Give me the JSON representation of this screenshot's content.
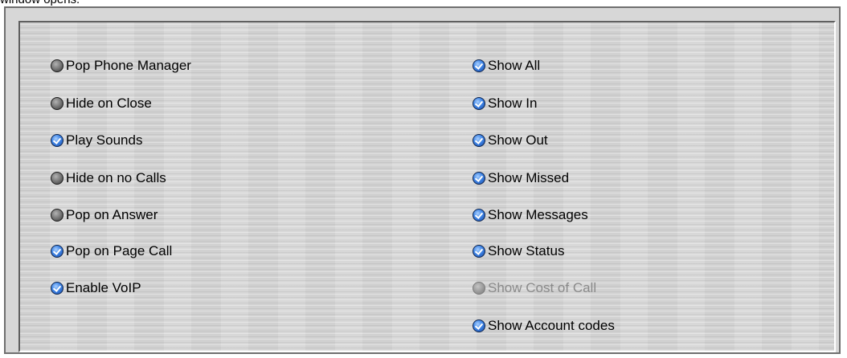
{
  "caption": "window opens.",
  "left_options": [
    {
      "label": "Pop Phone Manager",
      "checked": false,
      "enabled": true
    },
    {
      "label": "Hide on Close",
      "checked": false,
      "enabled": true
    },
    {
      "label": "Play Sounds",
      "checked": true,
      "enabled": true
    },
    {
      "label": "Hide on no Calls",
      "checked": false,
      "enabled": true
    },
    {
      "label": "Pop on Answer",
      "checked": false,
      "enabled": true
    },
    {
      "label": "Pop on Page Call",
      "checked": true,
      "enabled": true
    },
    {
      "label": "Enable VoIP",
      "checked": true,
      "enabled": true
    }
  ],
  "right_options": [
    {
      "label": "Show All",
      "checked": true,
      "enabled": true
    },
    {
      "label": "Show In",
      "checked": true,
      "enabled": true
    },
    {
      "label": "Show Out",
      "checked": true,
      "enabled": true
    },
    {
      "label": "Show Missed",
      "checked": true,
      "enabled": true
    },
    {
      "label": "Show Messages",
      "checked": true,
      "enabled": true
    },
    {
      "label": "Show Status",
      "checked": true,
      "enabled": true
    },
    {
      "label": "Show Cost of Call",
      "checked": false,
      "enabled": false
    },
    {
      "label": "Show Account codes",
      "checked": true,
      "enabled": true
    }
  ],
  "colors": {
    "checked_blue": "#3f85e6",
    "unchecked_gray": "#7c7c7c",
    "disabled_text": "#8a8a8a",
    "panel_background": "#d6d6d6"
  }
}
